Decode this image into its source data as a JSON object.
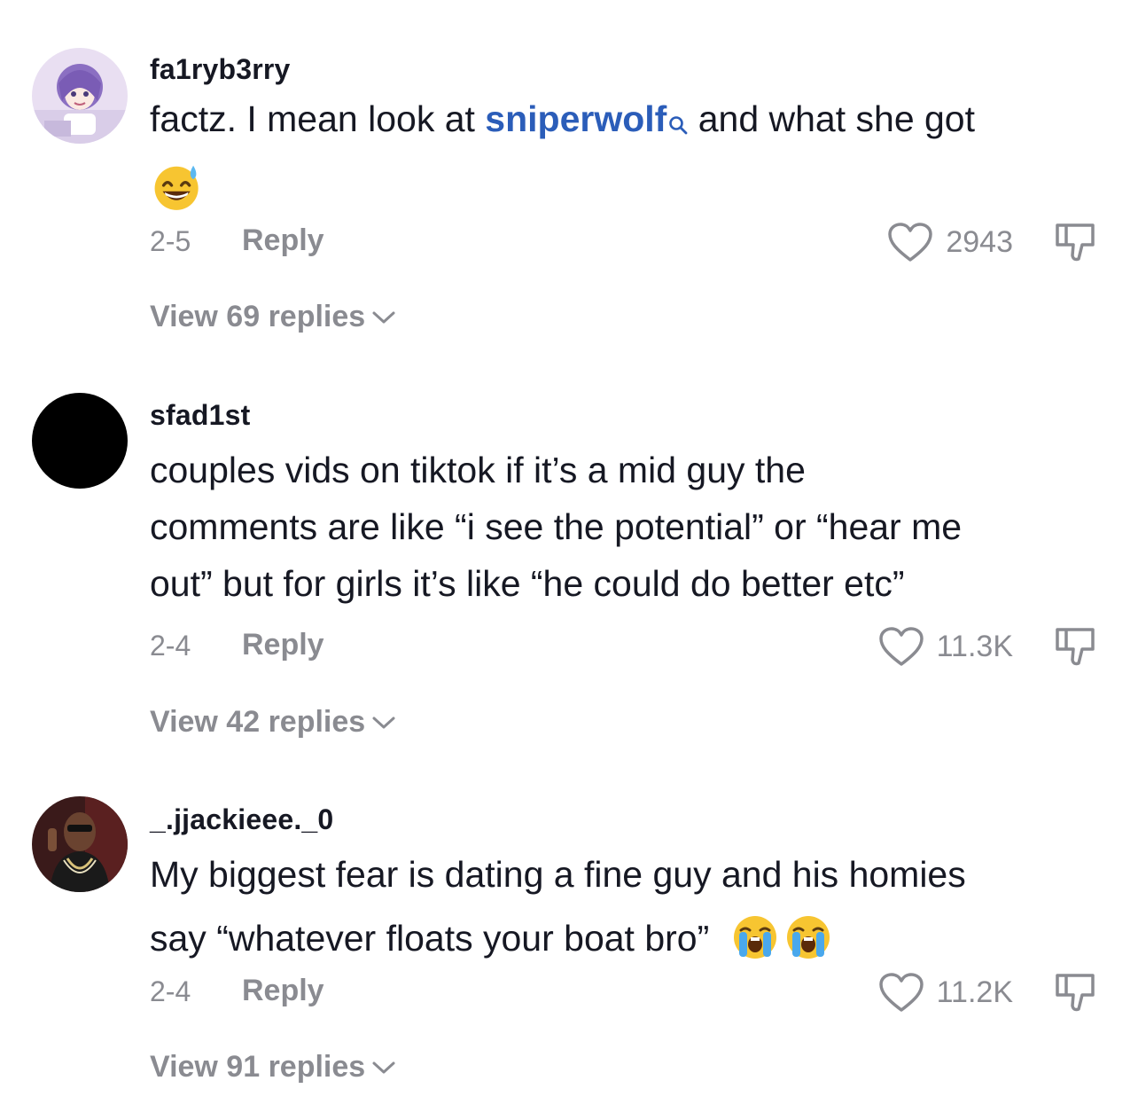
{
  "comments": [
    {
      "username": "fa1ryb3rry",
      "text_before": "factz. I mean look at ",
      "mention": "sniperwolf",
      "text_after": " and what she got",
      "emoji": "grinning-face-with-sweat",
      "date": "2-5",
      "reply_label": "Reply",
      "likes": "2943",
      "view_replies": "View 69 replies"
    },
    {
      "username": "sfad1st",
      "lines": [
        "couples vids on tiktok if it’s a mid guy the",
        "comments are like “i see the potential” or “hear me",
        "out” but for girls it’s like “he could do better etc”"
      ],
      "date": "2-4",
      "reply_label": "Reply",
      "likes": "11.3K",
      "view_replies": "View 42 replies"
    },
    {
      "username": "_.jjackieee._0",
      "line1": "My biggest fear is dating a fine guy and his homies",
      "line2": "say “whatever floats your boat bro”",
      "emoji": "loudly-crying-face",
      "date": "2-4",
      "reply_label": "Reply",
      "likes": "11.2K",
      "view_replies": "View 91 replies"
    }
  ],
  "icons": {
    "like": "heart-outline-icon",
    "dislike": "thumbs-down-outline-icon",
    "mention_search": "search-icon",
    "expand": "chevron-down-icon"
  },
  "colors": {
    "text": "#161823",
    "muted": "#8a8b91",
    "mention": "#2b5db9"
  }
}
